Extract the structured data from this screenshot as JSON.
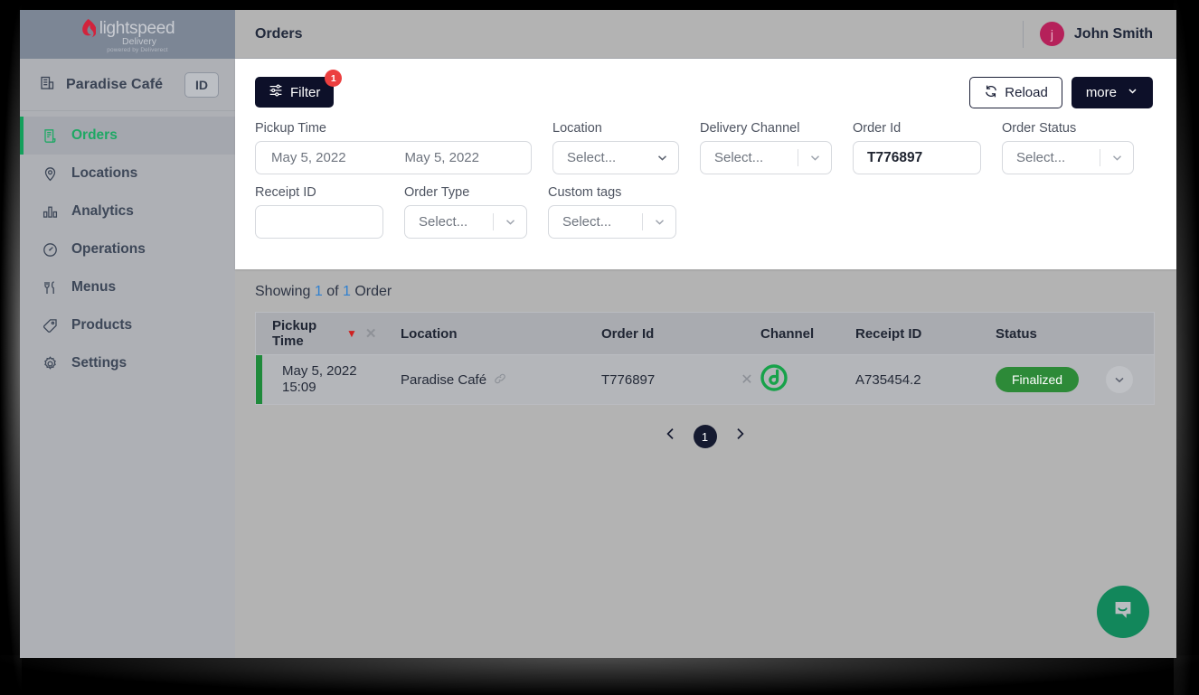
{
  "brand": {
    "wordmark": "lightspeed",
    "product": "Delivery",
    "tagline": "powered by Deliverect",
    "logo_icon": "flame-icon"
  },
  "sidebar": {
    "store": {
      "name": "Paradise Café",
      "icon": "building-icon",
      "id_button": "ID"
    },
    "items": [
      {
        "label": "Orders",
        "icon": "receipt-icon",
        "active": true
      },
      {
        "label": "Locations",
        "icon": "map-pin-icon",
        "active": false
      },
      {
        "label": "Analytics",
        "icon": "bar-chart-icon",
        "active": false
      },
      {
        "label": "Operations",
        "icon": "gauge-icon",
        "active": false
      },
      {
        "label": "Menus",
        "icon": "cutlery-icon",
        "active": false
      },
      {
        "label": "Products",
        "icon": "tag-icon",
        "active": false
      },
      {
        "label": "Settings",
        "icon": "gear-icon",
        "active": false
      }
    ]
  },
  "topbar": {
    "title": "Orders",
    "user": {
      "name": "John Smith",
      "avatar_initial": "j",
      "avatar_color": "#b5215a"
    }
  },
  "toolbar": {
    "filter_label": "Filter",
    "filter_icon": "sliders-icon",
    "filter_badge": "1",
    "reload_label": "Reload",
    "reload_icon": "refresh-icon",
    "more_label": "more",
    "more_icon": "chevron-down-icon"
  },
  "filters": {
    "pickup_time": {
      "label": "Pickup Time",
      "from_value": "May 5, 2022",
      "to_value": "May 5, 2022"
    },
    "location": {
      "label": "Location",
      "value": "Select..."
    },
    "delivery_channel": {
      "label": "Delivery Channel",
      "value": "Select..."
    },
    "order_id": {
      "label": "Order Id",
      "value": "T776897",
      "placeholder": ""
    },
    "order_status": {
      "label": "Order Status",
      "value": "Select..."
    },
    "receipt_id": {
      "label": "Receipt ID",
      "value": "",
      "placeholder": ""
    },
    "order_type": {
      "label": "Order Type",
      "value": "Select..."
    },
    "custom_tags": {
      "label": "Custom tags",
      "value": "Select..."
    }
  },
  "results": {
    "showing_prefix": "Showing",
    "showing_count": "1",
    "showing_of": "of",
    "showing_total": "1",
    "showing_suffix": "Order",
    "columns": [
      {
        "key": "pickup_time",
        "label_line1": "Pickup",
        "label_line2": "Time",
        "sort_icon": "sort-desc-icon",
        "clear_icon": "close-icon"
      },
      {
        "key": "location",
        "label": "Location"
      },
      {
        "key": "order_id",
        "label": "Order Id"
      },
      {
        "key": "channel",
        "label": "Channel"
      },
      {
        "key": "receipt_id",
        "label": "Receipt ID"
      },
      {
        "key": "status",
        "label": "Status"
      }
    ],
    "rows": [
      {
        "pickup_date": "May 5, 2022",
        "pickup_time": "15:09",
        "location": "Paradise Café",
        "location_link_icon": "link-icon",
        "order_id": "T776897",
        "order_id_clear_icon": "close-icon",
        "channel_icon": "deliverect-logo-icon",
        "receipt_id": "A735454.2",
        "status": "Finalized",
        "status_color": "#2d8a38",
        "accent_color": "#1f8a3b",
        "expand_icon": "chevron-down-icon"
      }
    ]
  },
  "pagination": {
    "prev_icon": "chevron-left-icon",
    "next_icon": "chevron-right-icon",
    "pages": [
      "1"
    ],
    "current": "1"
  },
  "chat": {
    "icon": "chat-bubble-icon",
    "color": "#12875b"
  }
}
